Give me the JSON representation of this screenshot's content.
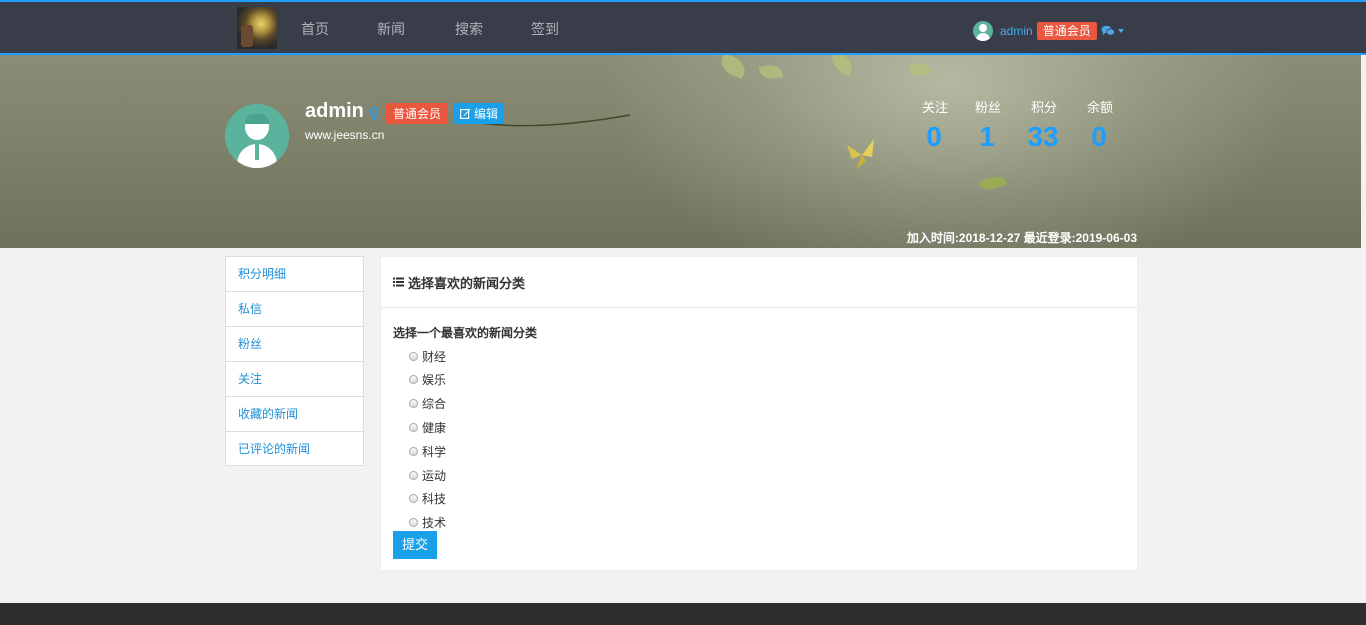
{
  "nav": {
    "links": [
      "首页",
      "新闻",
      "搜索",
      "签到"
    ],
    "user_name": "admin",
    "user_level": "普通会员"
  },
  "profile": {
    "name": "admin",
    "level_badge": "普通会员",
    "edit_label": "编辑",
    "website": "www.jeesns.cn",
    "stats": [
      {
        "label": "关注",
        "value": "0"
      },
      {
        "label": "粉丝",
        "value": "1"
      },
      {
        "label": "积分",
        "value": "33"
      },
      {
        "label": "余额",
        "value": "0"
      }
    ],
    "join_info": "加入时间:2018-12-27 最近登录:2019-06-03"
  },
  "sidebar": {
    "items": [
      "积分明细",
      "私信",
      "粉丝",
      "关注",
      "收藏的新闻",
      "已评论的新闻"
    ]
  },
  "panel": {
    "title": "选择喜欢的新闻分类",
    "question": "选择一个最喜欢的新闻分类",
    "options": [
      "财经",
      "娱乐",
      "综合",
      "健康",
      "科学",
      "运动",
      "科技",
      "技术"
    ],
    "submit_label": "提交"
  },
  "colors": {
    "nav_bg": "#393d49",
    "accent_blue": "#1e9fff",
    "badge_orange": "#e9573f",
    "avatar_green": "#5bb39e"
  }
}
